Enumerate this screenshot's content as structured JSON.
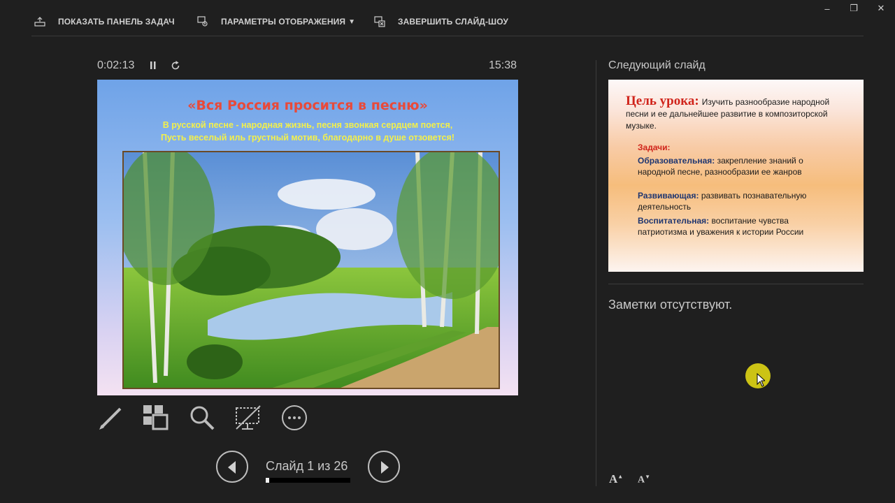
{
  "toolbar": {
    "show_taskbar": "ПОКАЗАТЬ ПАНЕЛЬ ЗАДАЧ",
    "display_settings": "ПАРАМЕТРЫ ОТОБРАЖЕНИЯ",
    "display_settings_caret": "▼",
    "end_show": "ЗАВЕРШИТЬ СЛАЙД-ШОУ"
  },
  "window": {
    "minimize": "–",
    "restore": "❐",
    "close": "✕"
  },
  "presenter": {
    "elapsed": "0:02:13",
    "clock": "15:38",
    "slide_counter": "Слайд 1 из 26",
    "progress_fraction": 0.0385
  },
  "current_slide": {
    "title": "«Вся Россия просится в песню»",
    "line1": "В русской песне - народная жизнь, песня звонкая сердцем поется,",
    "line2": "Пусть веселый иль грустный мотив, благодарно в душе отзовется!"
  },
  "next_slide": {
    "label": "Следующий слайд",
    "goal_title": "Цель урока:",
    "goal_text": "Изучить разнообразие народной песни и ее дальнейшее развитие в композиторской музыке.",
    "tasks_head": "Задачи:",
    "item1_head": "Образовательная:",
    "item1_text": "закрепление знаний о народной песне, разнообразии ее жанров",
    "item2_head": "Развивающая:",
    "item2_text": "развивать познавательную деятельность",
    "item3_head": "Воспитательная:",
    "item3_text": "воспитание чувства патриотизма и уважения к истории России"
  },
  "notes": "Заметки отсутствуют.",
  "font_controls": {
    "increase": "A",
    "decrease": "A"
  },
  "colors": {
    "background": "#1f1f1f",
    "text": "#c8c8c8",
    "title_red": "#d0241b",
    "cursor_highlight": "#ebe114"
  }
}
